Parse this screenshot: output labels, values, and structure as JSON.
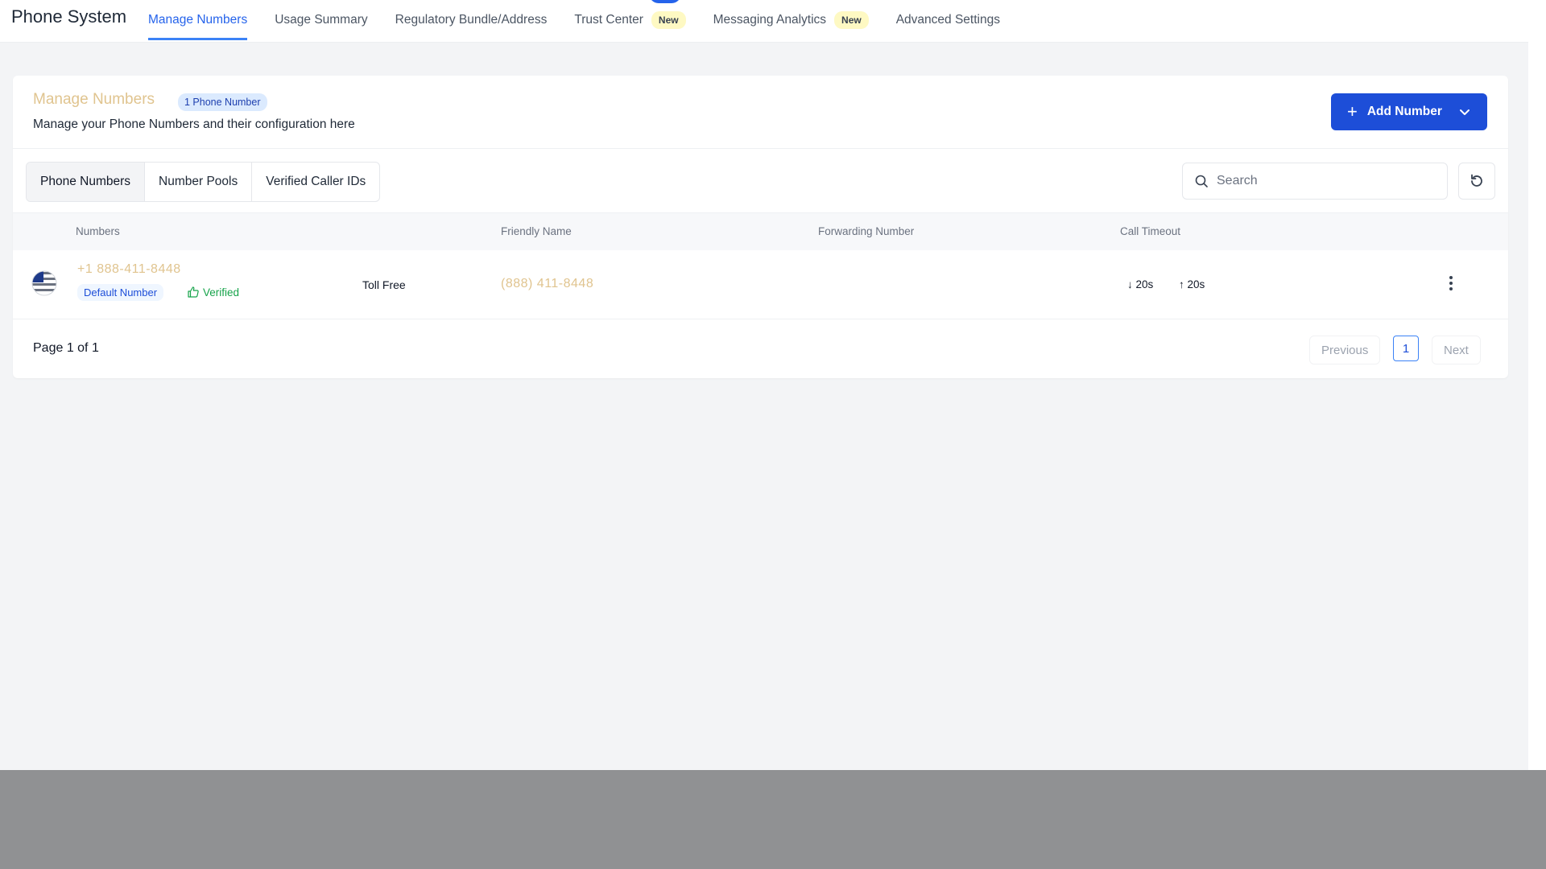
{
  "app": {
    "title": "Phone System"
  },
  "nav": {
    "tabs": [
      {
        "label": "Manage Numbers",
        "active": true
      },
      {
        "label": "Usage Summary"
      },
      {
        "label": "Regulatory Bundle/Address"
      },
      {
        "label": "Trust Center",
        "badge": "New"
      },
      {
        "label": "Messaging Analytics",
        "badge": "New"
      },
      {
        "label": "Advanced Settings"
      }
    ]
  },
  "header": {
    "title": "Manage Numbers",
    "count_badge": "1 Phone Number",
    "subtitle": "Manage your Phone Numbers and their configuration here",
    "add_button": "Add Number"
  },
  "segments": [
    {
      "label": "Phone Numbers",
      "active": true
    },
    {
      "label": "Number Pools"
    },
    {
      "label": "Verified Caller IDs"
    }
  ],
  "search": {
    "placeholder": "Search",
    "value": ""
  },
  "table": {
    "columns": [
      "Numbers",
      "Friendly Name",
      "Forwarding Number",
      "Call Timeout"
    ],
    "rows": [
      {
        "number": "+1 888-411-8448",
        "default_badge": "Default Number",
        "verified": "Verified",
        "type": "Toll Free",
        "friendly_name": "(888) 411-8448",
        "forwarding": "",
        "timeout_in": "20s",
        "timeout_out": "20s"
      }
    ]
  },
  "pagination": {
    "page_text": "Page 1 of 1",
    "previous": "Previous",
    "current": "1",
    "next": "Next"
  },
  "colors": {
    "primary": "#1d4ed8",
    "accent_link": "#e0c48f",
    "verified": "#16a34a",
    "badge_bg": "#fef9c3"
  }
}
